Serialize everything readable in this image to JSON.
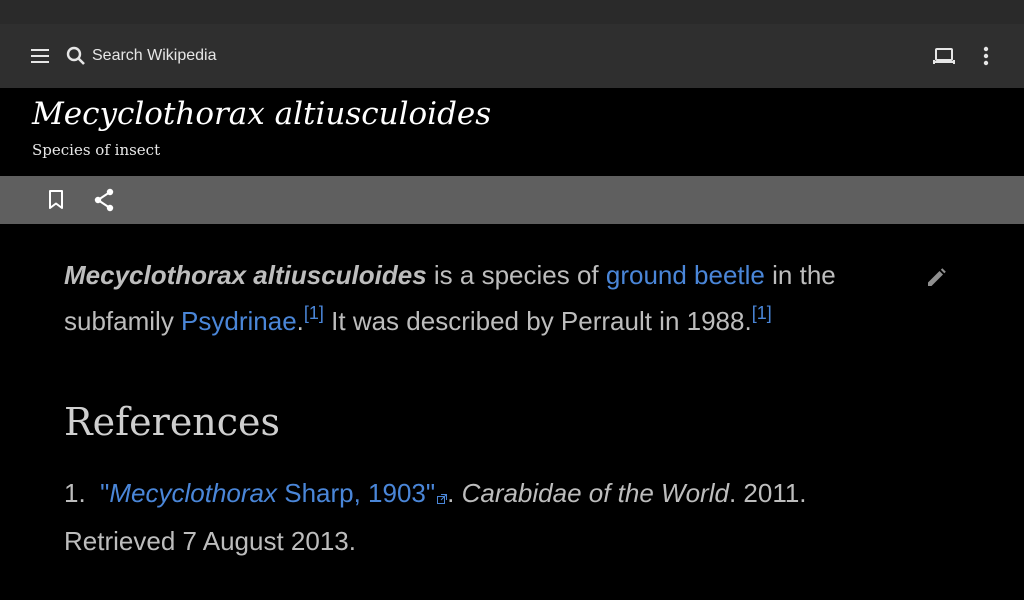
{
  "appbar": {
    "search_placeholder": "Search Wikipedia",
    "icons": [
      "menu-icon",
      "search-icon",
      "tabs-icon",
      "overflow-icon"
    ]
  },
  "article": {
    "title": "Mecyclothorax altiusculoides",
    "subtitle": "Species of insect",
    "lead": {
      "bold_name": "Mecyclothorax altiusculoides",
      "text1": " is a species of ",
      "link1": "ground beetle",
      "text2": " in the subfamily ",
      "link2": "Psydrinae",
      "text3": ".",
      "ref1": "[1]",
      "text4": " It was described by Perrault in 1988.",
      "ref2": "[1]"
    }
  },
  "references": {
    "heading": "References",
    "items": [
      {
        "number": "1.",
        "quote_open": "\"",
        "link_italic": "Mecyclothorax",
        "link_rest": " Sharp, 1903\"",
        "after_link": ". ",
        "source_italic": "Carabidae of the World",
        "tail": ". 2011. Retrieved 7 August 2013."
      }
    ]
  },
  "colors": {
    "link": "#4a86d8",
    "appbar": "#2f2f2f",
    "actionbar": "#5f5f5f",
    "background": "#000000"
  }
}
